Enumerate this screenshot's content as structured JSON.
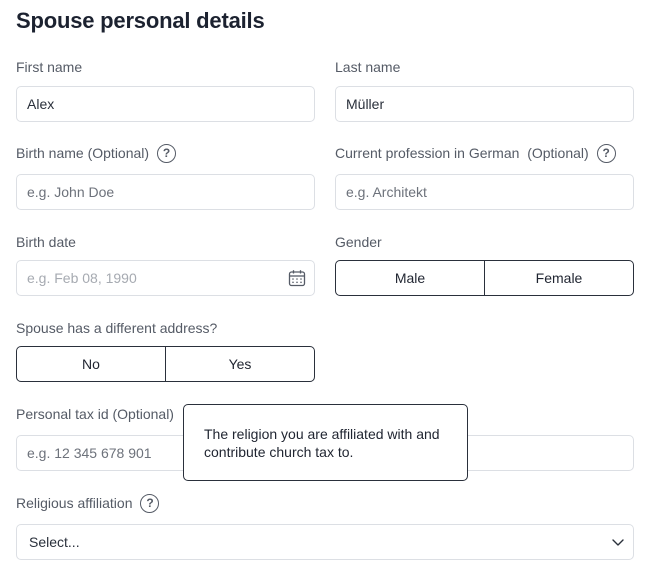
{
  "page": {
    "title": "Spouse personal details"
  },
  "fields": {
    "first_name": {
      "label": "First name",
      "value": "Alex"
    },
    "last_name": {
      "label": "Last name",
      "value": "Müller"
    },
    "birth_name": {
      "label": "Birth name (Optional)",
      "placeholder": "e.g. John Doe"
    },
    "profession": {
      "label": "Current profession in German  (Optional)",
      "placeholder": "e.g. Architekt"
    },
    "birth_date": {
      "label": "Birth date",
      "placeholder": "e.g. Feb 08, 1990"
    },
    "gender": {
      "label": "Gender",
      "options": [
        "Male",
        "Female"
      ]
    },
    "different_address": {
      "label": "Spouse has a different address?",
      "options": [
        "No",
        "Yes"
      ]
    },
    "tax_id": {
      "label": "Personal tax id (Optional)",
      "placeholder": "e.g. 12 345 678 901"
    },
    "religion": {
      "label": "Religious affiliation",
      "selected": "Select..."
    }
  },
  "help_icon": {
    "glyph": "?"
  },
  "tooltip": {
    "text": "The religion you are affiliated with and contribute church tax to."
  }
}
